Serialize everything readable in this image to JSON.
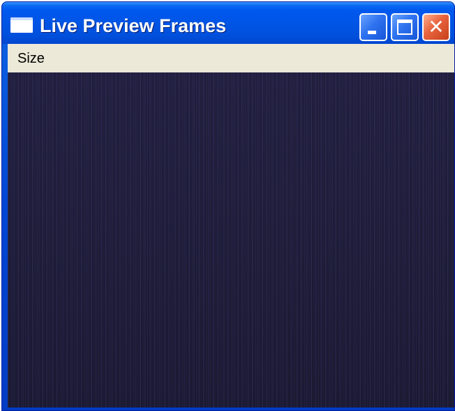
{
  "window": {
    "title": "Live Preview Frames",
    "icon": "window-icon",
    "controls": {
      "minimize_icon": "minimize-icon",
      "maximize_icon": "maximize-icon",
      "close_icon": "close-icon",
      "close_glyph": "✕"
    }
  },
  "menubar": {
    "items": [
      {
        "label": "Size"
      }
    ]
  },
  "preview": {
    "background": "#1b1a36"
  },
  "colors": {
    "titlebar": "#0055e5",
    "close_button": "#e8633d",
    "menubar": "#ece9d8"
  }
}
